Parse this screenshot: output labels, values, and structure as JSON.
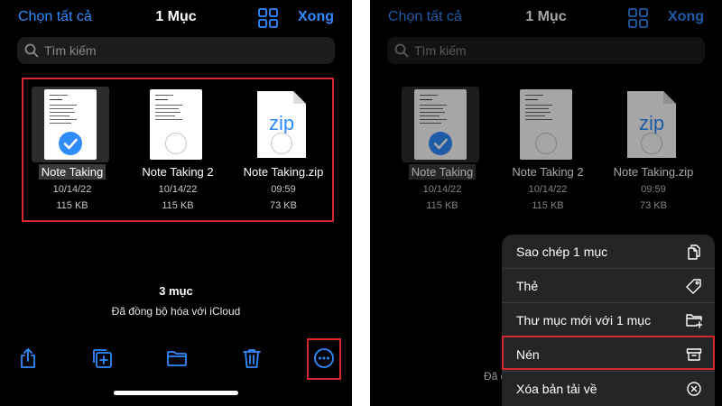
{
  "header": {
    "select_all": "Chọn tất cả",
    "title": "1 Mục",
    "done": "Xong"
  },
  "search": {
    "placeholder": "Tìm kiếm"
  },
  "files": [
    {
      "name": "Note Taking",
      "date": "10/14/22",
      "size": "115 KB",
      "selected": true,
      "type": "document"
    },
    {
      "name": "Note Taking 2",
      "date": "10/14/22",
      "size": "115 KB",
      "selected": false,
      "type": "document"
    },
    {
      "name": "Note Taking.zip",
      "date": "09:59",
      "size": "73 KB",
      "selected": false,
      "type": "zip",
      "badge": "zip"
    }
  ],
  "footer": {
    "count": "3 mục",
    "sync_status": "Đã đồng bộ hóa với iCloud",
    "sync_status_partial": "Đã đ"
  },
  "toolbar": {
    "icons": [
      "share-icon",
      "duplicate-icon",
      "folder-icon",
      "trash-icon",
      "more-icon"
    ]
  },
  "menu": {
    "items": [
      {
        "label": "Sao chép 1 mục",
        "icon": "copy-icon"
      },
      {
        "label": "Thẻ",
        "icon": "tag-icon"
      },
      {
        "label": "Thư mục mới với 1 mục",
        "icon": "new-folder-icon"
      },
      {
        "label": "Nén",
        "icon": "archive-icon"
      },
      {
        "label": "Xóa bản tải về",
        "icon": "remove-download-icon"
      }
    ]
  },
  "colors": {
    "accent": "#2f8cff",
    "highlight": "#d7262e",
    "background": "#000000",
    "menu_bg": "#252527"
  }
}
